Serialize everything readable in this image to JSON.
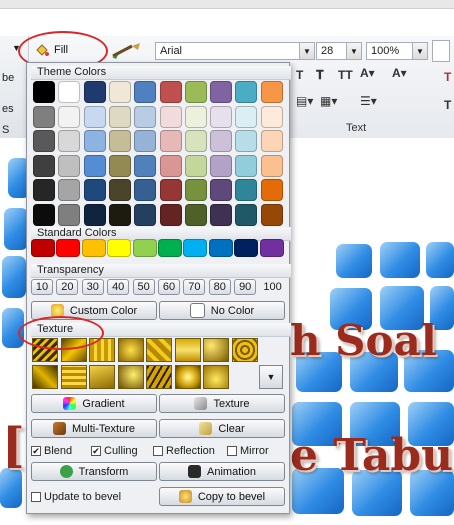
{
  "toolbar": {
    "fill_label": "Fill",
    "font_name": "Arial",
    "font_size": "28",
    "zoom": "100%",
    "text_group_label": "Text",
    "left_fragments": [
      "be",
      "es",
      "S"
    ]
  },
  "panel": {
    "theme_colors_title": "Theme Colors",
    "theme_colors": [
      [
        "#000000",
        "#ffffff",
        "#1f3b6e",
        "#efe8d6",
        "#4f80c0",
        "#c0504d",
        "#9bbb59",
        "#8064a2",
        "#4bacc6",
        "#f79646"
      ],
      [
        "#7f7f7f",
        "#f2f2f2",
        "#c6d9f1",
        "#ddd9c3",
        "#b8cce4",
        "#f2dcdb",
        "#ebf1dd",
        "#e5e0ec",
        "#dbeef3",
        "#fdeada"
      ],
      [
        "#595959",
        "#d8d8d8",
        "#8db3e2",
        "#c4bd97",
        "#95b3d7",
        "#e6b9b8",
        "#d7e3bc",
        "#ccc1d9",
        "#b7dde8",
        "#fbd5b5"
      ],
      [
        "#3f3f3f",
        "#bfbfbf",
        "#548dd4",
        "#938953",
        "#4f81bd",
        "#d99694",
        "#c3d69b",
        "#b2a2c7",
        "#92cddc",
        "#fac08f"
      ],
      [
        "#262626",
        "#a5a5a5",
        "#1f497d",
        "#4a442a",
        "#366092",
        "#953734",
        "#76923c",
        "#5f497a",
        "#31859b",
        "#e36c09"
      ],
      [
        "#0c0c0c",
        "#7f7f7f",
        "#0f243e",
        "#1d1b10",
        "#244061",
        "#632423",
        "#4f6128",
        "#3f3151",
        "#205867",
        "#974806"
      ]
    ],
    "standard_colors_title": "Standard Colors",
    "standard_colors": [
      "#c00000",
      "#ff0000",
      "#ffc000",
      "#ffff00",
      "#92d050",
      "#00b050",
      "#00b0f0",
      "#0070c0",
      "#002060",
      "#7030a0"
    ],
    "transparency_title": "Transparency",
    "transparency_values": [
      "10",
      "20",
      "30",
      "40",
      "50",
      "60",
      "70",
      "80",
      "90",
      "100"
    ],
    "custom_color_label": "Custom Color",
    "no_color_label": "No Color",
    "texture_title": "Texture",
    "gradient_label": "Gradient",
    "texture_button_label": "Texture",
    "multi_texture_label": "Multi-Texture",
    "clear_label": "Clear",
    "blend_label": "Blend",
    "culling_label": "Culling",
    "reflection_label": "Reflection",
    "mirror_label": "Mirror",
    "blend_checked": true,
    "culling_checked": true,
    "reflection_checked": false,
    "mirror_checked": false,
    "transform_label": "Transform",
    "animation_label": "Animation",
    "update_to_bevel_label": "Update to bevel",
    "copy_to_bevel_label": "Copy to bevel"
  },
  "slide": {
    "text_line1": "h Soal",
    "text_line2": "e Tabu",
    "left_mark": "["
  },
  "accent": {
    "annotation_red": "#d62a2a"
  }
}
